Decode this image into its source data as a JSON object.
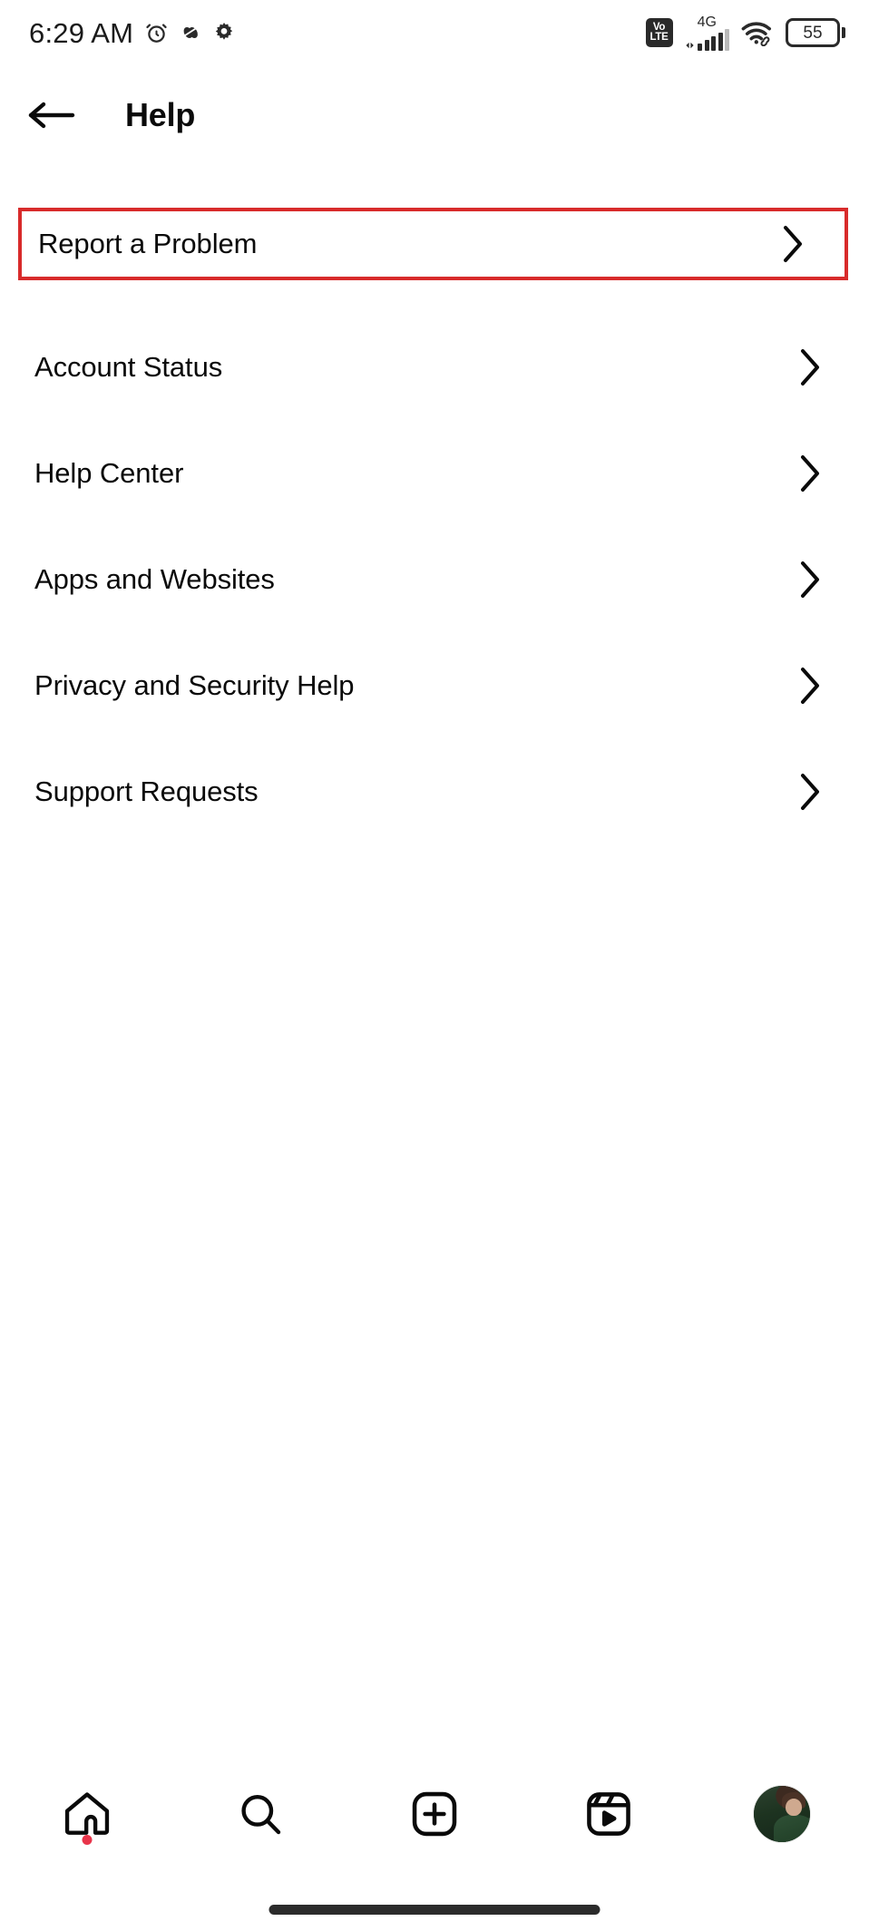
{
  "status_bar": {
    "time": "6:29 AM",
    "left_icons": [
      "alarm-clock-icon",
      "dnd-icon",
      "gear-icon"
    ],
    "network_label": "4G",
    "volte_top": "Vo",
    "volte_bottom": "LTE",
    "signal_bars": 4,
    "wifi": "wifi-icon",
    "wifi_badge": "link-icon",
    "battery_percent": "55"
  },
  "header": {
    "back_label": "back-arrow",
    "title": "Help"
  },
  "menu": {
    "items": [
      {
        "label": "Report a Problem",
        "name": "menu-item-report-a-problem",
        "highlighted": true
      },
      {
        "label": "Account Status",
        "name": "menu-item-account-status",
        "highlighted": false
      },
      {
        "label": "Help Center",
        "name": "menu-item-help-center",
        "highlighted": false
      },
      {
        "label": "Apps and Websites",
        "name": "menu-item-apps-and-websites",
        "highlighted": false
      },
      {
        "label": "Privacy and Security Help",
        "name": "menu-item-privacy-and-security-help",
        "highlighted": false
      },
      {
        "label": "Support Requests",
        "name": "menu-item-support-requests",
        "highlighted": false
      }
    ],
    "chevron": "chevron-right-icon",
    "highlight_color": "#D82B2B"
  },
  "bottom_nav": {
    "items": [
      {
        "icon": "home-icon",
        "name": "nav-home",
        "badge": true
      },
      {
        "icon": "search-icon",
        "name": "nav-search",
        "badge": false
      },
      {
        "icon": "create-icon",
        "name": "nav-create",
        "badge": false
      },
      {
        "icon": "reels-icon",
        "name": "nav-reels",
        "badge": false
      },
      {
        "icon": "avatar-icon",
        "name": "nav-profile",
        "badge": false
      }
    ],
    "badge_color": "#E8344A"
  },
  "gesture_bar": {
    "name": "home-gesture-bar"
  }
}
